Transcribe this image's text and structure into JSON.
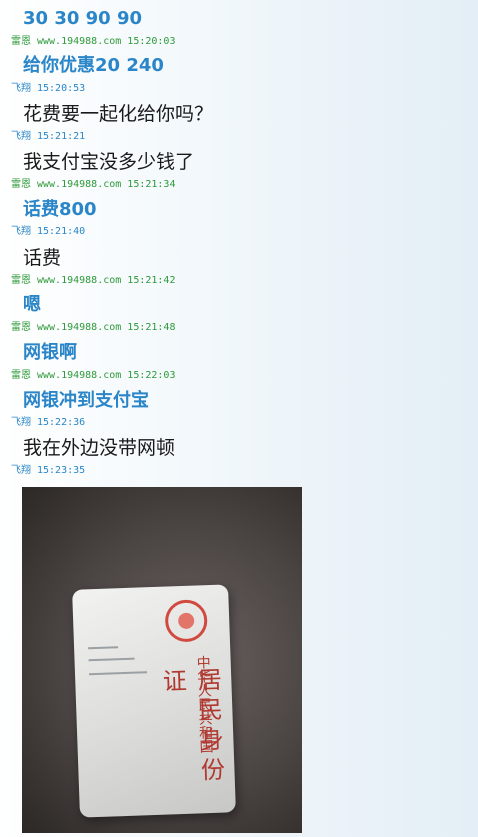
{
  "messages": [
    {
      "text": "30  30  90  90",
      "style": "bold"
    },
    {
      "text": "给你优惠20    240",
      "style": "bold"
    },
    {
      "text": "花费要一起化给你吗？",
      "style": "plain"
    },
    {
      "text": "我支付宝没多少钱了",
      "style": "plain"
    },
    {
      "text": "话费800",
      "style": "bold"
    },
    {
      "text": "话费",
      "style": "plain"
    },
    {
      "text": "嗯",
      "style": "bold"
    },
    {
      "text": "网银啊",
      "style": "bold"
    },
    {
      "text": "网银冲到支付宝",
      "style": "bold"
    },
    {
      "text": "我在外边没带网顿",
      "style": "plain"
    }
  ],
  "metas": [
    {
      "name": "雷恩",
      "site": "www.194988.com",
      "time": "15:20:03",
      "color": "#2e9a3a"
    },
    {
      "name": "飞翔",
      "site": "",
      "time": "15:20:53",
      "color": "#2a86c8"
    },
    {
      "name": "飞翔",
      "site": "",
      "time": "15:21:21",
      "color": "#2a86c8"
    },
    {
      "name": "雷恩",
      "site": "www.194988.com",
      "time": "15:21:34",
      "color": "#2e9a3a"
    },
    {
      "name": "飞翔",
      "site": "",
      "time": "15:21:40",
      "color": "#2a86c8"
    },
    {
      "name": "雷恩",
      "site": "www.194988.com",
      "time": "15:21:42",
      "color": "#2e9a3a"
    },
    {
      "name": "雷恩",
      "site": "www.194988.com",
      "time": "15:21:48",
      "color": "#2e9a3a"
    },
    {
      "name": "雷恩",
      "site": "www.194988.com",
      "time": "15:22:03",
      "color": "#2e9a3a"
    },
    {
      "name": "飞翔",
      "site": "",
      "time": "15:22:36",
      "color": "#2a86c8"
    },
    {
      "name": "飞翔",
      "site": "",
      "time": "15:23:35",
      "color": "#2a86c8"
    }
  ],
  "photo": {
    "card_country": "中华人民共和国",
    "card_title": "居民身份证"
  }
}
